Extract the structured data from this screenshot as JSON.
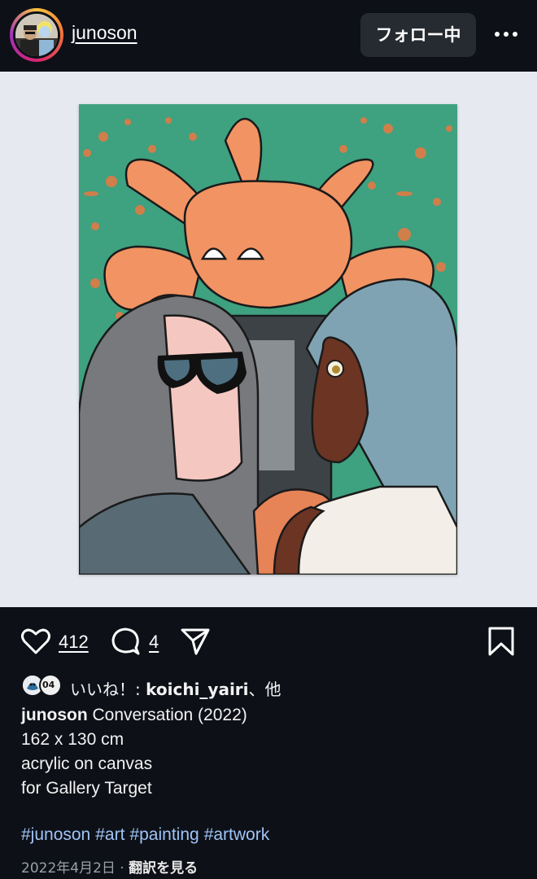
{
  "header": {
    "username": "junoson",
    "follow_label": "フォロー中",
    "more_icon": "more-horizontal-icon"
  },
  "post": {
    "image_icon": "artwork-image"
  },
  "actions": {
    "like_count": "412",
    "comment_count": "4",
    "icons": [
      "heart-icon",
      "comment-icon",
      "share-icon",
      "bookmark-icon"
    ]
  },
  "likes": {
    "prefix": "いいね！: ",
    "user": "koichi_yairi",
    "suffix": "、他",
    "badge_text": "04"
  },
  "caption": {
    "user": "junoson",
    "title": " Conversation (2022)",
    "line2": "162 x 130 cm",
    "line3": "acrylic on canvas",
    "line4": "for Gallery Target"
  },
  "hashtags": [
    "#junoson",
    "#art",
    "#painting",
    "#artwork"
  ],
  "footer": {
    "date": "2022年4月2日",
    "separator": " · ",
    "translate_label": "翻訳を見る"
  },
  "colors": {
    "background": "#0d1017",
    "image_background": "#e7e9f0",
    "hashtag": "#9fc4f6",
    "button": "#262a31"
  }
}
